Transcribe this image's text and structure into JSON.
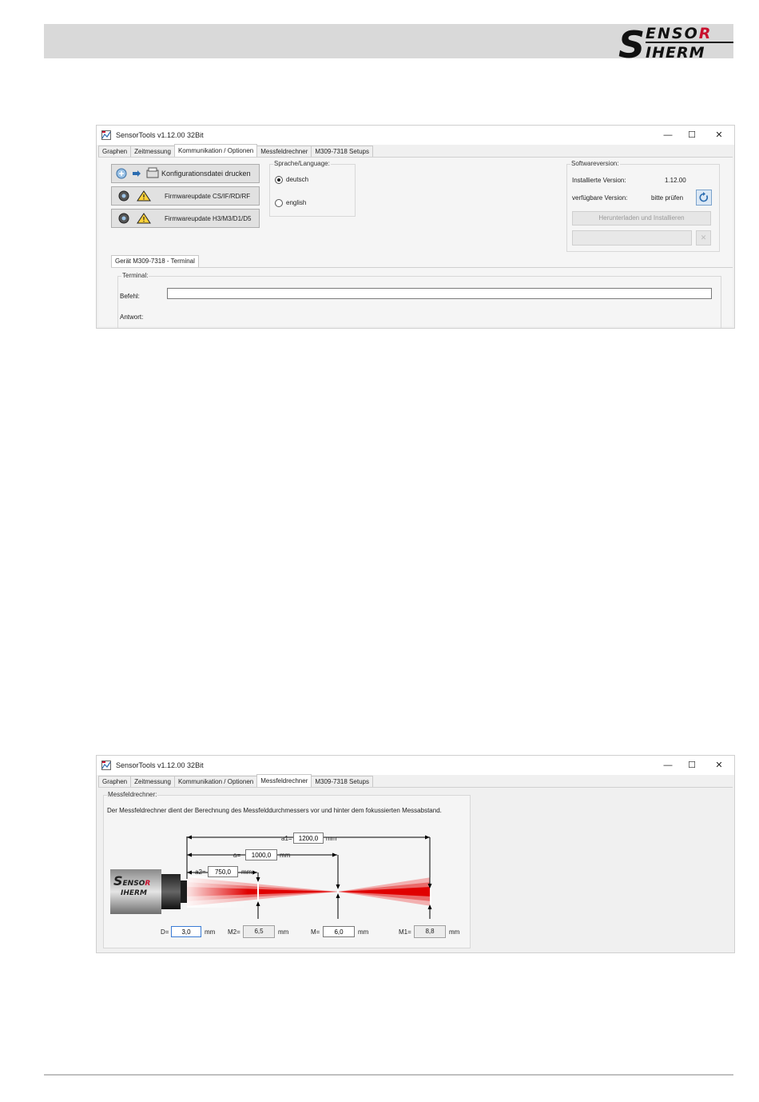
{
  "header": {
    "logo_top": "SENSOR",
    "logo_bottom": "THERM"
  },
  "windows": [
    {
      "title": "SensorTools v1.12.00 32Bit",
      "controls": {
        "minimize": "—",
        "maximize": "☐",
        "close": "✕"
      },
      "tabs": [
        "Graphen",
        "Zeitmessung",
        "Kommunikation / Optionen",
        "Messfeldrechner",
        "M309-7318 Setups"
      ],
      "active_tab": 2,
      "buttons": {
        "print_config": "Konfigurationsdatei drucken",
        "fw_update_1": "Firmwareupdate CS/IF/RD/RF",
        "fw_update_2": "Firmwareupdate H3/M3/D1/D5"
      },
      "language": {
        "label": "Sprache/Language:",
        "options": [
          "deutsch",
          "english"
        ],
        "selected": "deutsch"
      },
      "software": {
        "label": "Softwareversion:",
        "installed_label": "Installierte Version:",
        "installed_value": "1.12.00",
        "available_label": "verfügbare Version:",
        "available_value": "bitte prüfen",
        "download_button": "Herunterladen und Installieren"
      },
      "device_tab": "Gerät M309-7318 - Terminal",
      "terminal": {
        "label": "Terminal:",
        "command_label": "Befehl:",
        "answer_label": "Antwort:"
      }
    },
    {
      "title": "SensorTools v1.12.00 32Bit",
      "controls": {
        "minimize": "—",
        "maximize": "☐",
        "close": "✕"
      },
      "tabs": [
        "Graphen",
        "Zeitmessung",
        "Kommunikation / Optionen",
        "Messfeldrechner",
        "M309-7318 Setups"
      ],
      "active_tab": 3,
      "calc": {
        "label": "Messfeldrechner:",
        "description": "Der Messfeldrechner dient der Berechnung des Messfelddurchmessers vor und hinter dem fokussierten Messabstand.",
        "a1_label": "a1=",
        "a1_value": "1200,0",
        "a_label": "a=",
        "a_value": "1000,0",
        "a2_label": "a2=",
        "a2_value": "750,0",
        "unit": "mm",
        "D_label": "D=",
        "D_value": "3,0",
        "M2_label": "M2=",
        "M2_value": "6,5",
        "M_label": "M=",
        "M_value": "6,0",
        "M1_label": "M1=",
        "M1_value": "8,8",
        "sensor_logo_top": "SENSOR",
        "sensor_logo_bottom": "THERM"
      }
    }
  ]
}
